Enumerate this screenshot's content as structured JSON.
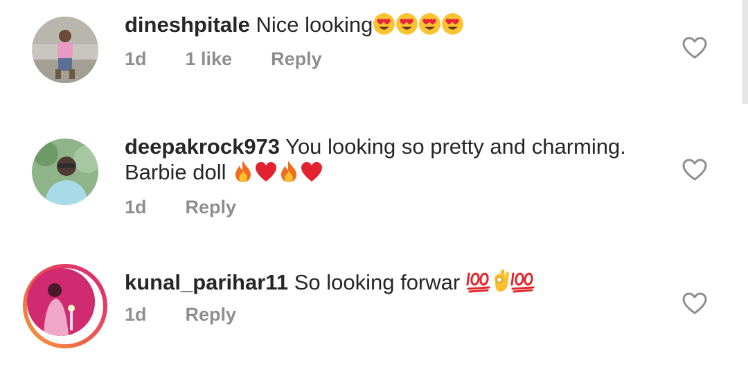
{
  "comments": [
    {
      "username": "dineshpitale",
      "text": "Nice looking",
      "emojis": [
        "heart-eyes",
        "heart-eyes",
        "heart-eyes",
        "heart-eyes"
      ],
      "time": "1d",
      "likes": "1 like",
      "reply": "Reply",
      "has_story": false
    },
    {
      "username": "deepakrock973",
      "text": "You looking so pretty and charming.",
      "text2": "Barbie doll",
      "emojis": [
        "fire",
        "red-heart",
        "fire",
        "red-heart"
      ],
      "time": "1d",
      "reply": "Reply",
      "has_story": false
    },
    {
      "username": "kunal_parihar11",
      "text": "So looking forwar",
      "emojis": [
        "hundred",
        "ok-hand",
        "hundred"
      ],
      "time": "1d",
      "reply": "Reply",
      "has_story": true
    }
  ],
  "colors": {
    "text": "#262626",
    "secondary": "#8e8e8e",
    "story_ring_start": "#f7a33c",
    "story_ring_end": "#d7217f"
  },
  "icons": {
    "like": "heart-outline-icon"
  }
}
